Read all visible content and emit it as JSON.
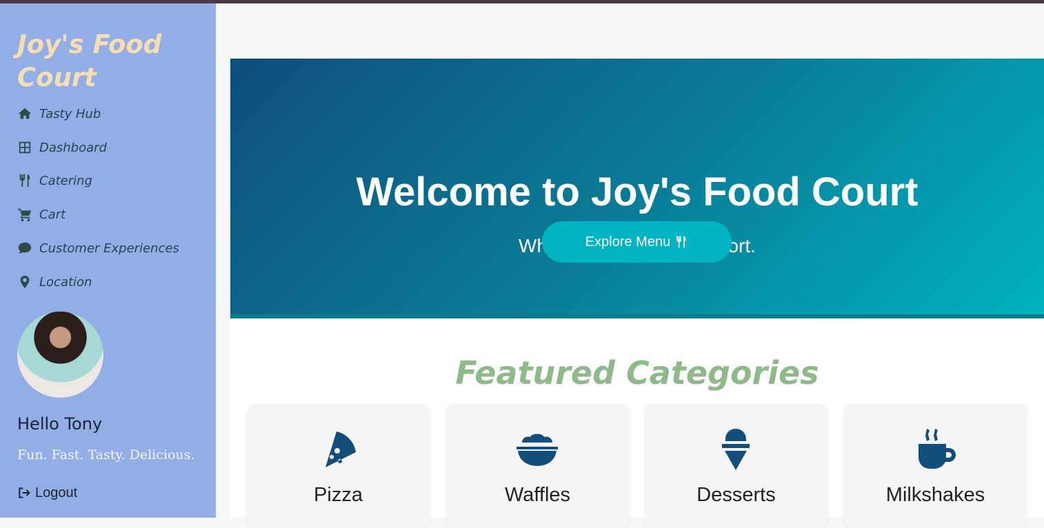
{
  "sidebar": {
    "brand": "Joy's Food Court",
    "nav": [
      {
        "label": "Tasty Hub",
        "icon": "home-icon"
      },
      {
        "label": "Dashboard",
        "icon": "grid-icon"
      },
      {
        "label": "Catering",
        "icon": "utensils-icon"
      },
      {
        "label": "Cart",
        "icon": "cart-icon"
      },
      {
        "label": "Customer Experiences",
        "icon": "comment-icon"
      },
      {
        "label": "Location",
        "icon": "map-pin-icon"
      }
    ],
    "greeting": "Hello Tony",
    "tagline": "Fun. Fast. Tasty. Delicious.",
    "logout": "Logout"
  },
  "hero": {
    "title": "Welcome to Joy's Food Court",
    "subtitle": "Where taste meets comfort.",
    "button": "Explore Menu"
  },
  "featured": {
    "title": "Featured Categories",
    "categories": [
      {
        "label": "Pizza",
        "icon": "pizza-icon"
      },
      {
        "label": "Waffles",
        "icon": "bowl-icon"
      },
      {
        "label": "Desserts",
        "icon": "ice-cream-icon"
      },
      {
        "label": "Milkshakes",
        "icon": "mug-icon"
      }
    ]
  },
  "colors": {
    "sidebar": "#93ade6",
    "brand": "#f5deb3",
    "hero_start": "#0f4e7c",
    "hero_end": "#00b2be",
    "accent_button": "#00b4c2",
    "featured_title": "#8fb98a",
    "category_icon": "#134e7a"
  }
}
